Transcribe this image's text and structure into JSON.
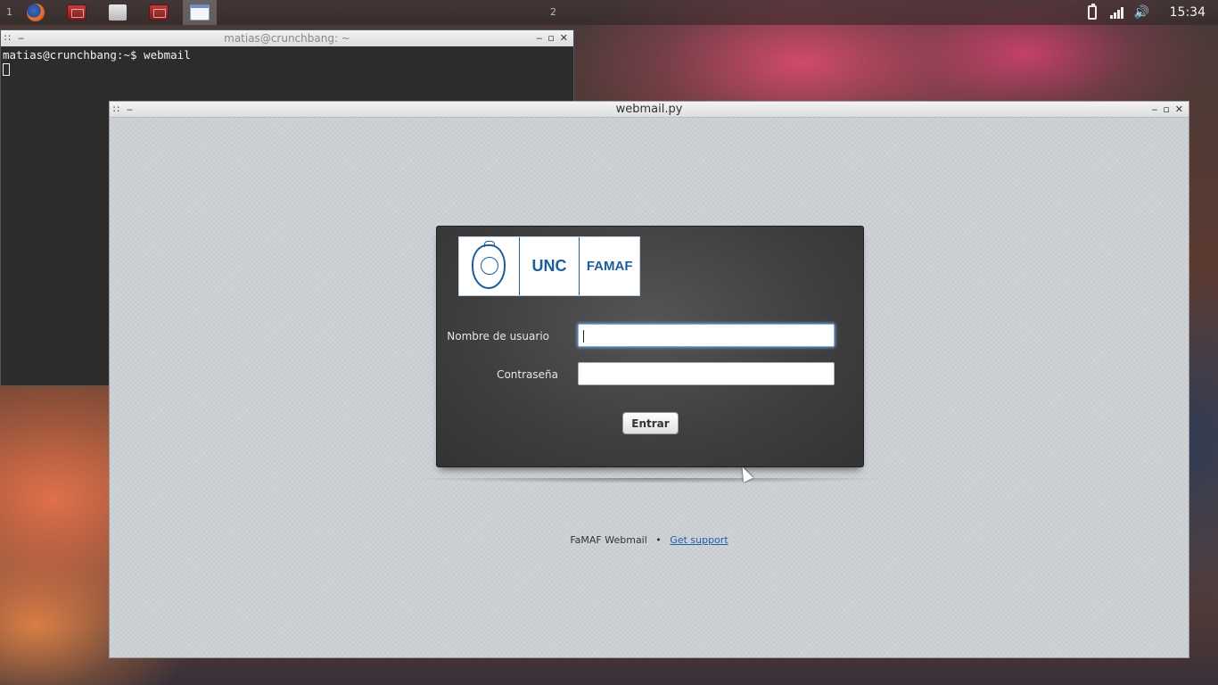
{
  "panel": {
    "workspace_1": "1",
    "workspace_2": "2",
    "tasks": [
      {
        "icon": "firefox-icon"
      },
      {
        "icon": "terminal-icon"
      },
      {
        "icon": "file-manager-icon"
      },
      {
        "icon": "terminal-icon"
      },
      {
        "icon": "window-icon",
        "active": true
      }
    ],
    "tray_icons": [
      "battery-icon",
      "signal-icon",
      "volume-icon"
    ],
    "volume_glyph": "🔊",
    "clock": "15:34"
  },
  "terminal": {
    "title": "matias@crunchbang: ~",
    "prompt_line": "matias@crunchbang:~$ webmail",
    "controls": {
      "minimize": "‒",
      "maximize": "▫",
      "close": "✕"
    },
    "left_glyphs": {
      "grip": "∷",
      "dash": "‒"
    }
  },
  "webmail": {
    "title": "webmail.py",
    "controls": {
      "minimize": "‒",
      "maximize": "▫",
      "close": "✕"
    },
    "left_glyphs": {
      "grip": "∷",
      "dash": "‒"
    },
    "logo": {
      "unc": "UNC",
      "famaf": "FAMAF"
    },
    "username_label": "Nombre de usuario",
    "username_value": "",
    "password_label": "Contraseña",
    "password_value": "",
    "submit_label": "Entrar",
    "footer": {
      "brand": "FaMAF Webmail",
      "separator": "•",
      "support_link": "Get support"
    }
  },
  "colors": {
    "card_bg": "#3e3e3e",
    "logo_blue": "#1b5e9a",
    "link_blue": "#1f5fb0"
  }
}
